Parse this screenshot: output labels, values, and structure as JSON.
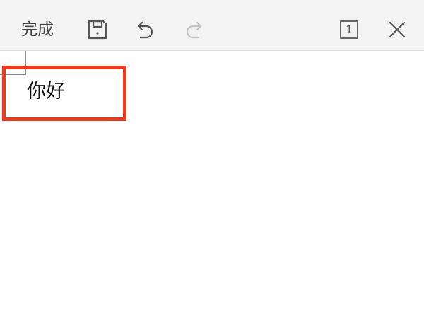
{
  "toolbar": {
    "done_label": "完成",
    "page_number": "1",
    "icons": {
      "save": "save-icon",
      "undo": "undo-icon",
      "redo": "redo-icon",
      "page": "page-count-icon",
      "close": "close-icon"
    },
    "redo_enabled": false
  },
  "document": {
    "text": "你好"
  },
  "colors": {
    "toolbar_bg": "#f3f3f3",
    "icon": "#555555",
    "icon_disabled": "#c4c4c4",
    "selection_frame": "#e83a1e"
  }
}
